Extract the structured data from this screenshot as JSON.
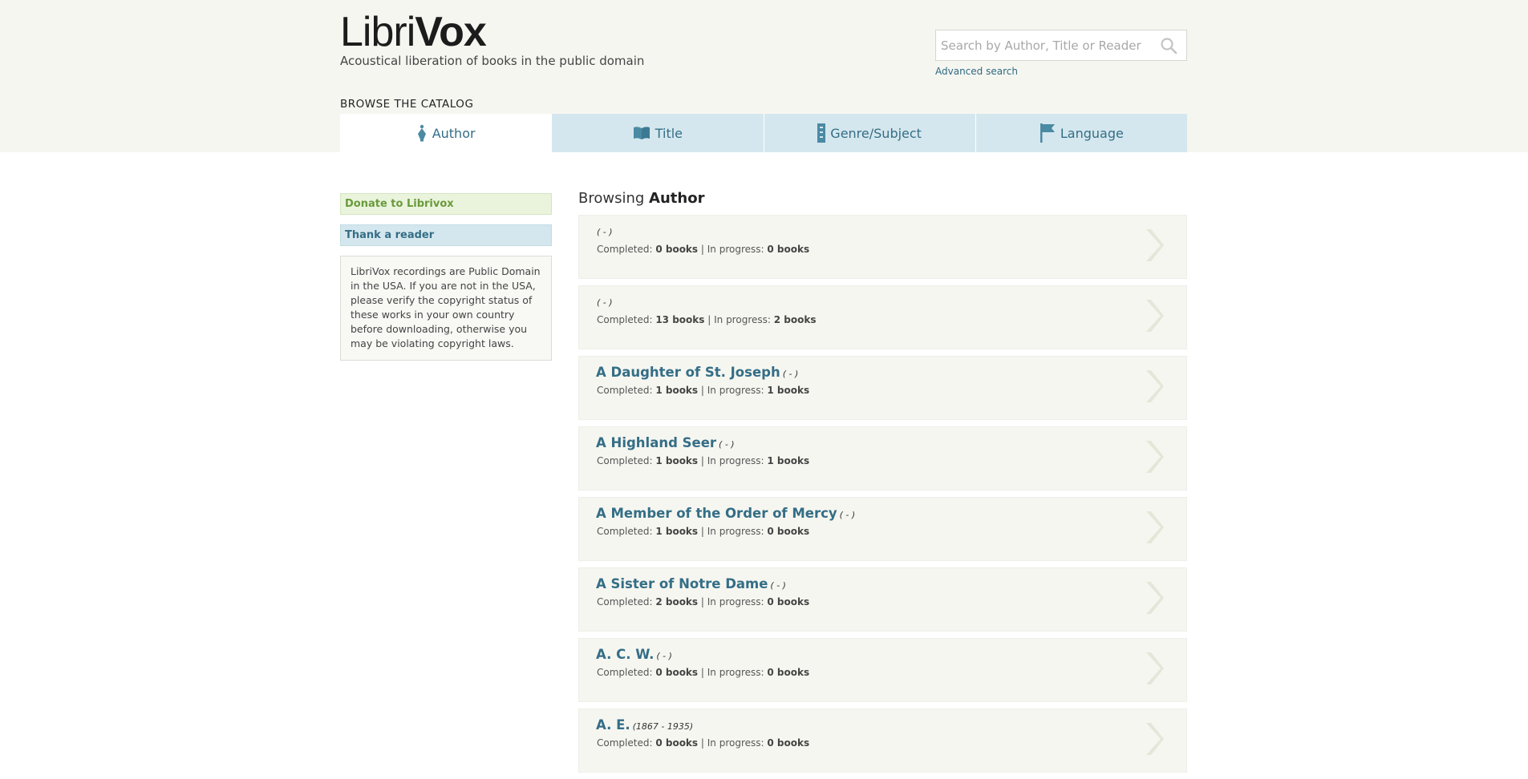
{
  "header": {
    "logo_part1": "Libri",
    "logo_part2": "Vox",
    "tagline": "Acoustical liberation of books in the public domain",
    "search_placeholder": "Search by Author, Title or Reader",
    "advanced_search": "Advanced search"
  },
  "catalog": {
    "title": "BROWSE THE CATALOG",
    "tabs": [
      {
        "label": "Author",
        "icon": "pen-nib-icon",
        "active": true
      },
      {
        "label": "Title",
        "icon": "book-icon",
        "active": false
      },
      {
        "label": "Genre/Subject",
        "icon": "bookmark-icon",
        "active": false
      },
      {
        "label": "Language",
        "icon": "flag-icon",
        "active": false
      }
    ]
  },
  "sidebar": {
    "donate": "Donate to Librivox",
    "thank": "Thank a reader",
    "note": "LibriVox recordings are Public Domain in the USA. If you are not in the USA, please verify the copyright status of these works in your own country before downloading, otherwise you may be violating copyright laws."
  },
  "main": {
    "browsing_prefix": "Browsing",
    "browsing_value": "Author",
    "completed_label": "Completed:",
    "separator": "|",
    "in_progress_label": "In progress:",
    "authors": [
      {
        "name": "",
        "dates": "( - )",
        "completed": "0 books",
        "in_progress": "0 books"
      },
      {
        "name": "",
        "dates": "( - )",
        "completed": "13 books",
        "in_progress": "2 books"
      },
      {
        "name": "A Daughter of St. Joseph",
        "dates": "( - )",
        "completed": "1 books",
        "in_progress": "1 books"
      },
      {
        "name": "A Highland Seer",
        "dates": "( - )",
        "completed": "1 books",
        "in_progress": "1 books"
      },
      {
        "name": "A Member of the Order of Mercy",
        "dates": "( - )",
        "completed": "1 books",
        "in_progress": "0 books"
      },
      {
        "name": "A Sister of Notre Dame",
        "dates": "( - )",
        "completed": "2 books",
        "in_progress": "0 books"
      },
      {
        "name": "A. C. W.",
        "dates": "( - )",
        "completed": "0 books",
        "in_progress": "0 books"
      },
      {
        "name": "A. E.",
        "dates": "(1867 - 1935)",
        "completed": "0 books",
        "in_progress": "0 books"
      }
    ]
  },
  "colors": {
    "accent": "#346e86",
    "donate_green": "#6a9a3c",
    "tab_bg": "#d5e7ee",
    "header_bg": "#f6f6f1"
  }
}
